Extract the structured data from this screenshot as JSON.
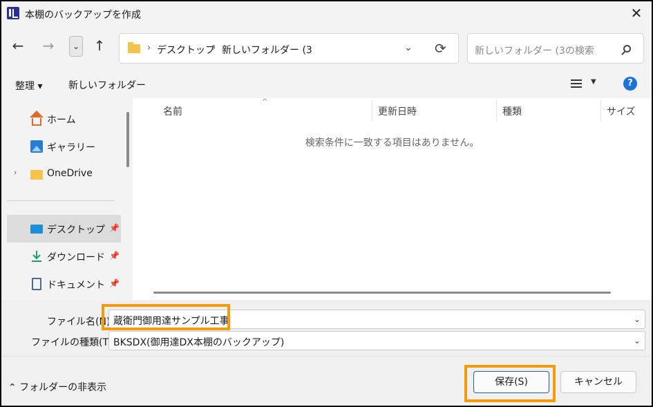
{
  "window": {
    "title": "本棚のバックアップを作成",
    "close": "✕"
  },
  "nav": {
    "back": "←",
    "forward": "→",
    "recent": "⌄",
    "up": "↑",
    "breadcrumb": [
      "デスクトップ",
      "新しいフォルダー (3"
    ],
    "crumb_sep": "›",
    "dropdown": "⌄",
    "refresh": "⟳",
    "search_placeholder": "新しいフォルダー (3の検索"
  },
  "toolbar": {
    "organize": "整理 ▾",
    "new_folder": "新しいフォルダー",
    "view_caret": "▼",
    "help": "?"
  },
  "sidebar": {
    "items": [
      {
        "label": "ホーム",
        "icon": "home-icon"
      },
      {
        "label": "ギャラリー",
        "icon": "gallery-icon"
      },
      {
        "label": "OneDrive",
        "icon": "folder-icon",
        "expand": "›"
      },
      {
        "label": "デスクトップ",
        "icon": "desktop-icon",
        "pinned": true,
        "active": true
      },
      {
        "label": "ダウンロード",
        "icon": "download-icon",
        "pinned": true
      },
      {
        "label": "ドキュメント",
        "icon": "document-icon",
        "pinned": true
      }
    ],
    "pin": "📌"
  },
  "file_list": {
    "columns": [
      "名前",
      "更新日時",
      "種類",
      "サイズ"
    ],
    "sort_arrow": "^",
    "empty_message": "検索条件に一致する項目はありません。"
  },
  "form": {
    "filename_label": "ファイル名(N):",
    "filename_value": "蔵衛門御用達サンプル工事",
    "filetype_label": "ファイルの種類(T):",
    "filetype_value": "BKSDX(御用達DX本棚のバックアップ)",
    "caret": "⌄"
  },
  "footer": {
    "hide_folders": "⌃ フォルダーの非表示",
    "save": "保存(S)",
    "cancel": "キャンセル"
  },
  "colors": {
    "highlight": "#f49b0c",
    "accent": "#1a73d9"
  }
}
